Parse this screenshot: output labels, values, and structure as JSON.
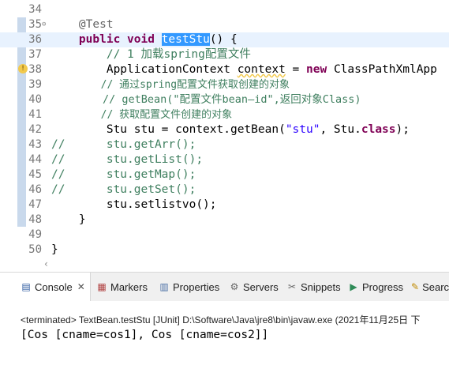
{
  "editor": {
    "lines": [
      {
        "num": "34",
        "fold": "",
        "text": ""
      },
      {
        "num": "35",
        "fold": "⊖",
        "text": "    @Test"
      },
      {
        "num": "36",
        "fold": "",
        "text": "    public void testStu() {"
      },
      {
        "num": "37",
        "fold": "",
        "text": "        // 1 加载spring配置文件"
      },
      {
        "num": "38",
        "fold": "",
        "text": "        ApplicationContext context = new ClassPathXmlApp"
      },
      {
        "num": "39",
        "fold": "",
        "text": "        // 通过spring配置文件获取创建的对象"
      },
      {
        "num": "40",
        "fold": "",
        "text": "        // getBean(\"配置文件bean—id\",返回对象Class)"
      },
      {
        "num": "41",
        "fold": "",
        "text": "        // 获取配置文件创建的对象"
      },
      {
        "num": "42",
        "fold": "",
        "text": "        Stu stu = context.getBean(\"stu\", Stu.class);"
      },
      {
        "num": "43",
        "fold": "",
        "text": "//      stu.getArr();"
      },
      {
        "num": "44",
        "fold": "",
        "text": "//      stu.getList();"
      },
      {
        "num": "45",
        "fold": "",
        "text": "//      stu.getMap();"
      },
      {
        "num": "46",
        "fold": "",
        "text": "//      stu.getSet();"
      },
      {
        "num": "47",
        "fold": "",
        "text": "        stu.setlistvo();"
      },
      {
        "num": "48",
        "fold": "",
        "text": "    }"
      },
      {
        "num": "49",
        "fold": "",
        "text": ""
      },
      {
        "num": "50",
        "fold": "",
        "text": "}"
      }
    ],
    "scroll_left": "‹"
  },
  "tabs": [
    {
      "label": "Console",
      "icon": "console-icon",
      "glyph": "▤",
      "close": "✕"
    },
    {
      "label": "Markers",
      "icon": "markers-icon",
      "glyph": "▦"
    },
    {
      "label": "Properties",
      "icon": "properties-icon",
      "glyph": "▥"
    },
    {
      "label": "Servers",
      "icon": "servers-icon",
      "glyph": "⚙"
    },
    {
      "label": "Snippets",
      "icon": "snippets-icon",
      "glyph": "✂"
    },
    {
      "label": "Progress",
      "icon": "progress-icon",
      "glyph": "▶"
    },
    {
      "label": "Search",
      "icon": "search-icon",
      "glyph": "✎"
    }
  ],
  "console": {
    "terminated": "<terminated> TextBean.testStu [JUnit] D:\\Software\\Java\\jre8\\bin\\javaw.exe  (2021年11月25日 下",
    "output": "[Cos [cname=cos1], Cos [cname=cos2]]"
  },
  "colors": {
    "keyword": "#7f0055",
    "comment": "#3f7f5f",
    "string": "#2a00ff",
    "field": "#0000c0",
    "selection": "#3399ff"
  }
}
